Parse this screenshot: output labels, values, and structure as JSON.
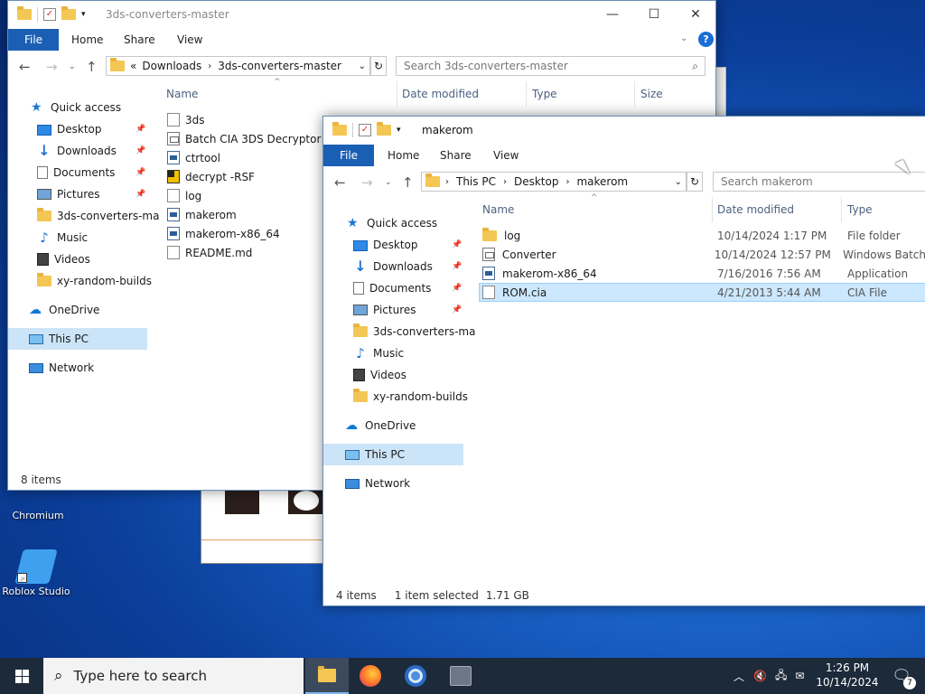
{
  "desktop": {
    "icons": [
      {
        "label": "Chromium"
      },
      {
        "label": "Roblox Studio"
      }
    ]
  },
  "back_window": {
    "title": "3ds-converters-master",
    "ribbon": {
      "file": "File",
      "tabs": [
        "Home",
        "Share",
        "View"
      ]
    },
    "address": {
      "prefix": "«",
      "crumbs": [
        "Downloads",
        "3ds-converters-master"
      ]
    },
    "search_placeholder": "Search 3ds-converters-master",
    "nav": [
      {
        "label": "Quick access",
        "icon": "star-icon"
      },
      {
        "label": "Desktop",
        "icon": "desktop-icon",
        "pinned": true
      },
      {
        "label": "Downloads",
        "icon": "downloads-icon",
        "pinned": true
      },
      {
        "label": "Documents",
        "icon": "documents-icon",
        "pinned": true
      },
      {
        "label": "Pictures",
        "icon": "pictures-icon",
        "pinned": true
      },
      {
        "label": "3ds-converters-ma",
        "icon": "folder-icon"
      },
      {
        "label": "Music",
        "icon": "music-icon"
      },
      {
        "label": "Videos",
        "icon": "videos-icon"
      },
      {
        "label": "xy-random-builds",
        "icon": "folder-icon"
      },
      {
        "label": "OneDrive",
        "icon": "onedrive-icon"
      },
      {
        "label": "This PC",
        "icon": "this-pc-icon",
        "selected": true
      },
      {
        "label": "Network",
        "icon": "network-icon"
      }
    ],
    "columns": [
      "Name",
      "Date modified",
      "Type",
      "Size"
    ],
    "files": [
      {
        "name": "3ds",
        "icon": "script-file-icon"
      },
      {
        "name": "Batch CIA 3DS Decryptor",
        "icon": "batch-file-icon"
      },
      {
        "name": "ctrtool",
        "icon": "application-icon"
      },
      {
        "name": "decrypt -RSF",
        "icon": "key-file-icon"
      },
      {
        "name": "log",
        "icon": "document-file-icon"
      },
      {
        "name": "makerom",
        "icon": "application-icon"
      },
      {
        "name": "makerom-x86_64",
        "icon": "application-icon"
      },
      {
        "name": "README.md",
        "icon": "document-file-icon"
      }
    ],
    "status": "8 items"
  },
  "front_window": {
    "title": "makerom",
    "ribbon": {
      "file": "File",
      "tabs": [
        "Home",
        "Share",
        "View"
      ]
    },
    "address": {
      "crumbs": [
        "This PC",
        "Desktop",
        "makerom"
      ]
    },
    "search_placeholder": "Search makerom",
    "nav": [
      {
        "label": "Quick access",
        "icon": "star-icon"
      },
      {
        "label": "Desktop",
        "icon": "desktop-icon",
        "pinned": true
      },
      {
        "label": "Downloads",
        "icon": "downloads-icon",
        "pinned": true
      },
      {
        "label": "Documents",
        "icon": "documents-icon",
        "pinned": true
      },
      {
        "label": "Pictures",
        "icon": "pictures-icon",
        "pinned": true
      },
      {
        "label": "3ds-converters-ma",
        "icon": "folder-icon"
      },
      {
        "label": "Music",
        "icon": "music-icon"
      },
      {
        "label": "Videos",
        "icon": "videos-icon"
      },
      {
        "label": "xy-random-builds",
        "icon": "folder-icon"
      },
      {
        "label": "OneDrive",
        "icon": "onedrive-icon"
      },
      {
        "label": "This PC",
        "icon": "this-pc-icon",
        "selected": true
      },
      {
        "label": "Network",
        "icon": "network-icon"
      }
    ],
    "columns": [
      "Name",
      "Date modified",
      "Type"
    ],
    "files": [
      {
        "name": "log",
        "date": "10/14/2024 1:17 PM",
        "type": "File folder",
        "icon": "folder-icon"
      },
      {
        "name": "Converter",
        "date": "10/14/2024 12:57 PM",
        "type": "Windows Batch",
        "icon": "batch-file-icon"
      },
      {
        "name": "makerom-x86_64",
        "date": "7/16/2016 7:56 AM",
        "type": "Application",
        "icon": "application-icon"
      },
      {
        "name": "ROM.cia",
        "date": "4/21/2013 5:44 AM",
        "type": "CIA File",
        "icon": "document-file-icon",
        "selected": true
      }
    ],
    "status": {
      "count": "4 items",
      "selection": "1 item selected",
      "size": "1.71 GB"
    }
  },
  "taskbar": {
    "search_placeholder": "Type here to search",
    "time": "1:26 PM",
    "date": "10/14/2024",
    "notification_count": "7"
  },
  "colors": {
    "accent": "#1a5fb4",
    "selection": "#cce8ff",
    "taskbar": "#1c2a3a"
  }
}
